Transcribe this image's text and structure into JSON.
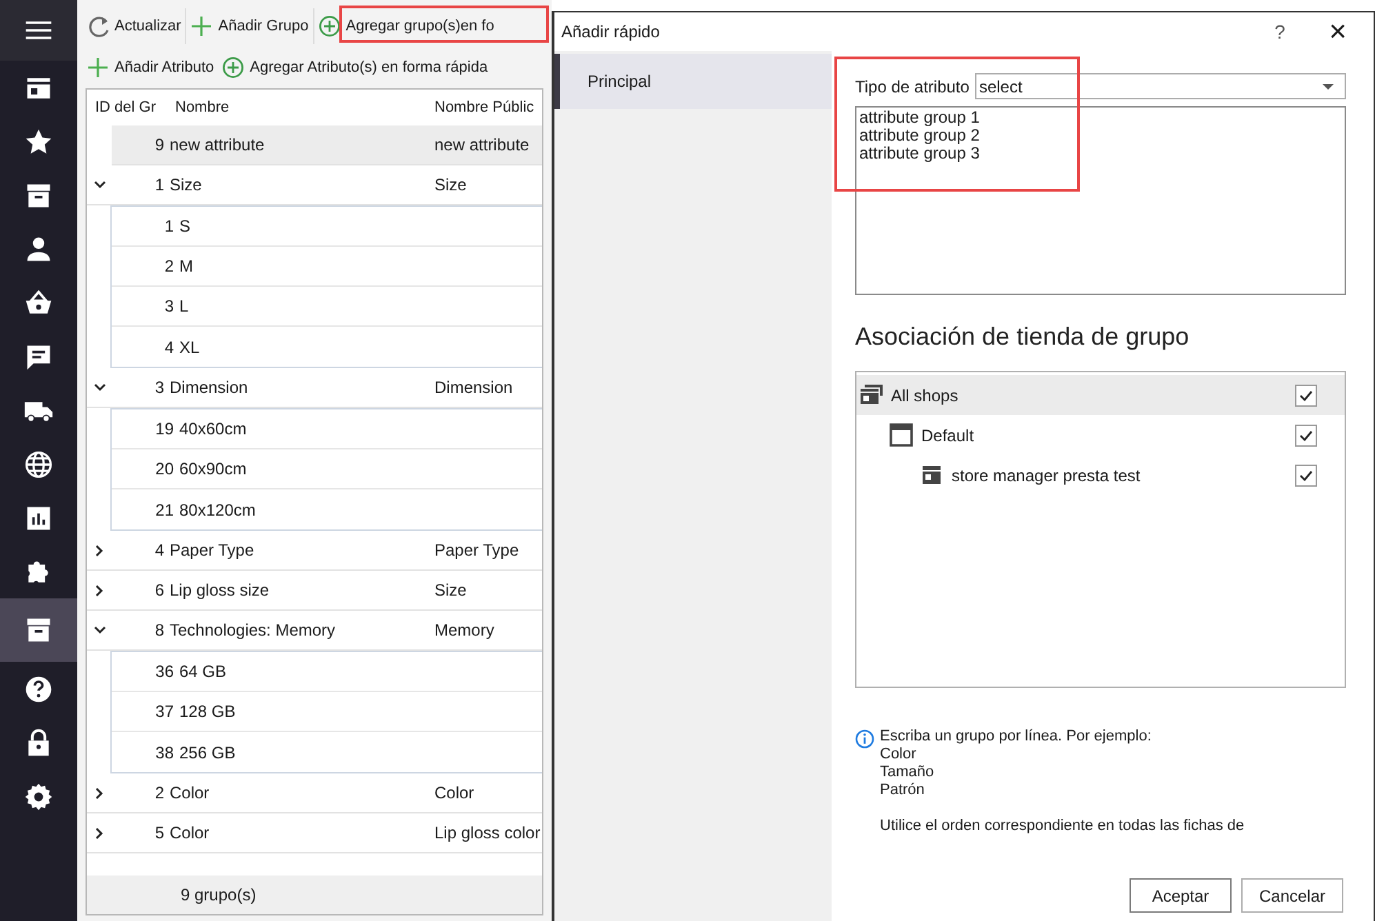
{
  "sidebar": {
    "items": [
      {
        "selected": false
      },
      {
        "selected": false
      },
      {
        "selected": false
      },
      {
        "selected": false
      },
      {
        "selected": false
      },
      {
        "selected": false
      },
      {
        "selected": false
      },
      {
        "selected": false
      },
      {
        "selected": false
      },
      {
        "selected": false
      },
      {
        "selected": false
      },
      {
        "selected": true
      },
      {
        "selected": false
      },
      {
        "selected": false
      },
      {
        "selected": false
      }
    ]
  },
  "toolbar": {
    "rows": [
      [
        {
          "kind": "refresh",
          "label": "Actualizar"
        },
        {
          "kind": "add",
          "label": "Añadir Grupo"
        },
        {
          "kind": "quick-add",
          "label": "Agregar grupo(s)en fo"
        }
      ],
      [
        {
          "kind": "add",
          "label": "Añadir Atributo"
        },
        {
          "kind": "quick-add",
          "label": "Agregar Atributo(s) en forma rápida"
        }
      ]
    ]
  },
  "table": {
    "columns": [
      "ID del Gr",
      "Nombre",
      "Nombre Públic"
    ],
    "groups": [
      {
        "id": "9",
        "name": "new attribute",
        "public_name": "new attribute",
        "selected": true
      },
      {
        "id": "1",
        "name": "Size",
        "public_name": "Size",
        "expanded": true,
        "selected": false,
        "children": [
          {
            "id": "1",
            "name": "S"
          },
          {
            "id": "2",
            "name": "M"
          },
          {
            "id": "3",
            "name": "L"
          },
          {
            "id": "4",
            "name": "XL"
          }
        ]
      },
      {
        "id": "3",
        "name": "Dimension",
        "public_name": "Dimension",
        "expanded": true,
        "selected": false,
        "children": [
          {
            "id": "19",
            "name": "40x60cm"
          },
          {
            "id": "20",
            "name": "60x90cm"
          },
          {
            "id": "21",
            "name": "80x120cm"
          }
        ]
      },
      {
        "id": "4",
        "name": "Paper Type",
        "public_name": "Paper Type",
        "expanded": false,
        "selected": false
      },
      {
        "id": "6",
        "name": "Lip gloss size",
        "public_name": "Size",
        "expanded": false,
        "selected": false
      },
      {
        "id": "8",
        "name": "Technologies: Memory",
        "public_name": "Memory",
        "expanded": true,
        "selected": false,
        "children": [
          {
            "id": "36",
            "name": "64 GB"
          },
          {
            "id": "37",
            "name": "128 GB"
          },
          {
            "id": "38",
            "name": "256 GB"
          }
        ]
      },
      {
        "id": "2",
        "name": "Color",
        "public_name": "Color",
        "expanded": false,
        "selected": false
      },
      {
        "id": "5",
        "name": "Color",
        "public_name": "Lip gloss color",
        "expanded": false,
        "selected": false
      }
    ],
    "footer": "9 grupo(s)"
  },
  "dialog": {
    "title": "Añadir rápido",
    "help": "?",
    "close": "×",
    "tabs": [
      {
        "label": "Principal",
        "selected": true
      }
    ],
    "attribute_type": {
      "label": "Tipo de atributo",
      "value": "select"
    },
    "groups_text": [
      "attribute group 1",
      "attribute group 2",
      "attribute group 3"
    ],
    "shop_heading": "Asociación de tienda de grupo",
    "shops": [
      {
        "label": "All shops",
        "checked": true,
        "selected": true,
        "children": [
          {
            "label": "Default",
            "checked": true,
            "selected": false,
            "children": [
              {
                "label": "store manager presta test",
                "checked": true,
                "selected": false
              }
            ]
          }
        ]
      }
    ],
    "info": [
      "Escriba un grupo por línea. Por ejemplo:",
      "Color",
      "Tamaño",
      "Patrón"
    ],
    "info_note": "Utilice el orden correspondiente en todas las fichas de",
    "buttons": [
      {
        "label": "Aceptar",
        "kind": "primary"
      },
      {
        "label": "Cancelar",
        "kind": "secondary"
      }
    ]
  }
}
